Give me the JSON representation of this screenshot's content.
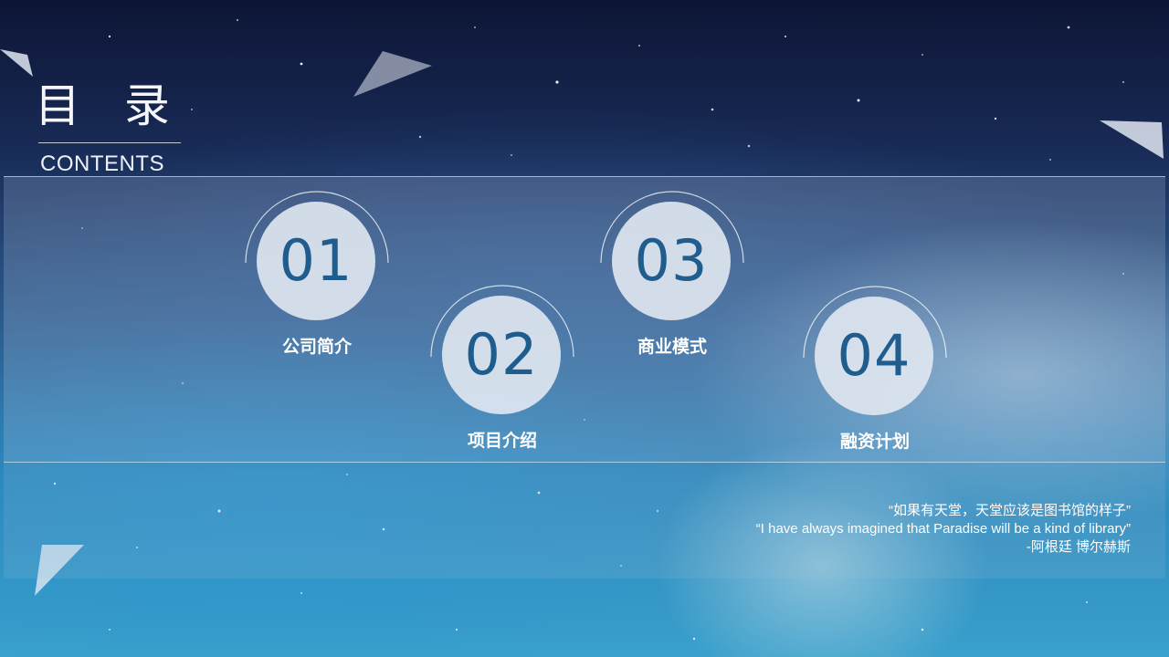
{
  "header": {
    "title": "目 录",
    "subtitle": "CONTENTS"
  },
  "toc": {
    "items": [
      {
        "number": "01",
        "label": "公司简介"
      },
      {
        "number": "02",
        "label": "项目介绍"
      },
      {
        "number": "03",
        "label": "商业模式"
      },
      {
        "number": "04",
        "label": "融资计划"
      }
    ]
  },
  "quote": {
    "chinese": "“如果有天堂，天堂应该是图书馆的样子”",
    "english": "“I have always imagined that Paradise will be a kind of library”",
    "author": "-阿根廷 博尔赫斯"
  },
  "colors": {
    "accent": "#1f5d8e",
    "circle_fill": "#dee6f0",
    "sky_top": "#0d1535",
    "sky_bottom": "#3aa0cc"
  }
}
